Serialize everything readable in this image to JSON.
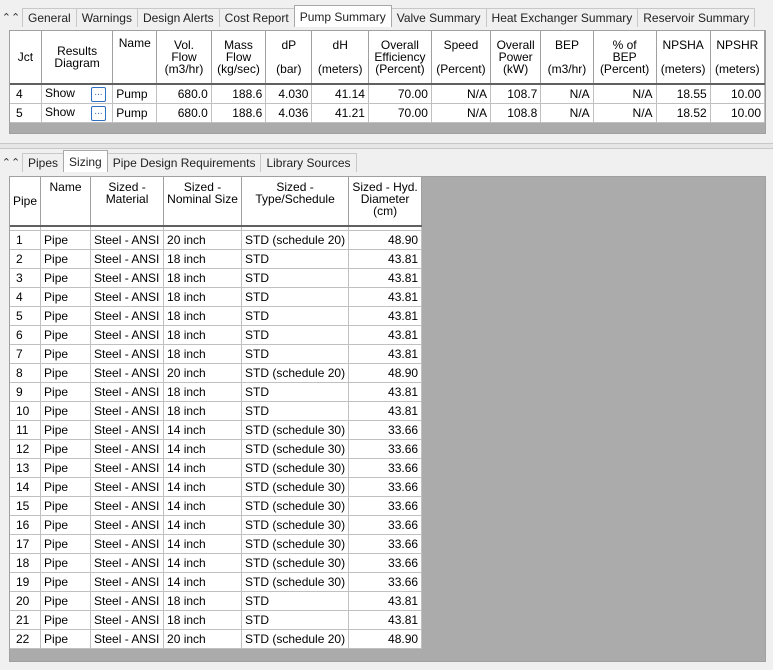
{
  "top": {
    "tabs": [
      "General",
      "Warnings",
      "Design Alerts",
      "Cost Report",
      "Pump Summary",
      "Valve Summary",
      "Heat Exchanger Summary",
      "Reservoir Summary"
    ],
    "active_tab": "Pump Summary",
    "columns": [
      {
        "top": "",
        "mid": "Jct",
        "unit": ""
      },
      {
        "top": "Results",
        "mid": "Diagram",
        "unit": ""
      },
      {
        "top": "Name",
        "mid": "",
        "unit": ""
      },
      {
        "top": "Vol.",
        "mid": "Flow",
        "unit": "(m3/hr)"
      },
      {
        "top": "Mass",
        "mid": "Flow",
        "unit": "(kg/sec)"
      },
      {
        "top": "dP",
        "mid": "",
        "unit": "(bar)"
      },
      {
        "top": "dH",
        "mid": "",
        "unit": "(meters)"
      },
      {
        "top": "Overall",
        "mid": "Efficiency",
        "unit": "(Percent)"
      },
      {
        "top": "Speed",
        "mid": "",
        "unit": "(Percent)"
      },
      {
        "top": "Overall",
        "mid": "Power",
        "unit": "(kW)"
      },
      {
        "top": "BEP",
        "mid": "",
        "unit": "(m3/hr)"
      },
      {
        "top": "% of",
        "mid": "BEP",
        "unit": "(Percent)"
      },
      {
        "top": "NPSHA",
        "mid": "",
        "unit": "(meters)"
      },
      {
        "top": "NPSHR",
        "mid": "",
        "unit": "(meters)"
      }
    ],
    "rows": [
      {
        "jct": "4",
        "diagram": "Show",
        "name": "Pump",
        "vol_flow": "680.0",
        "mass_flow": "188.6",
        "dp": "4.030",
        "dh": "41.14",
        "eff": "70.00",
        "speed": "N/A",
        "power": "108.7",
        "bep": "N/A",
        "pct_bep": "N/A",
        "npsha": "18.55",
        "npshr": "10.00"
      },
      {
        "jct": "5",
        "diagram": "Show",
        "name": "Pump",
        "vol_flow": "680.0",
        "mass_flow": "188.6",
        "dp": "4.036",
        "dh": "41.21",
        "eff": "70.00",
        "speed": "N/A",
        "power": "108.8",
        "bep": "N/A",
        "pct_bep": "N/A",
        "npsha": "18.52",
        "npshr": "10.00"
      }
    ]
  },
  "bottom": {
    "tabs": [
      "Pipes",
      "Sizing",
      "Pipe Design Requirements",
      "Library Sources"
    ],
    "active_tab": "Sizing",
    "columns": [
      "Pipe",
      "Name",
      "Sized - Material",
      "Sized - Nominal Size",
      "Sized - Type/Schedule",
      "Sized - Hyd. Diameter (cm)"
    ],
    "rows": [
      [
        "1",
        "Pipe",
        "Steel - ANSI",
        "20 inch",
        "STD (schedule 20)",
        "48.90"
      ],
      [
        "2",
        "Pipe",
        "Steel - ANSI",
        "18 inch",
        "STD",
        "43.81"
      ],
      [
        "3",
        "Pipe",
        "Steel - ANSI",
        "18 inch",
        "STD",
        "43.81"
      ],
      [
        "4",
        "Pipe",
        "Steel - ANSI",
        "18 inch",
        "STD",
        "43.81"
      ],
      [
        "5",
        "Pipe",
        "Steel - ANSI",
        "18 inch",
        "STD",
        "43.81"
      ],
      [
        "6",
        "Pipe",
        "Steel - ANSI",
        "18 inch",
        "STD",
        "43.81"
      ],
      [
        "7",
        "Pipe",
        "Steel - ANSI",
        "18 inch",
        "STD",
        "43.81"
      ],
      [
        "8",
        "Pipe",
        "Steel - ANSI",
        "20 inch",
        "STD (schedule 20)",
        "48.90"
      ],
      [
        "9",
        "Pipe",
        "Steel - ANSI",
        "18 inch",
        "STD",
        "43.81"
      ],
      [
        "10",
        "Pipe",
        "Steel - ANSI",
        "18 inch",
        "STD",
        "43.81"
      ],
      [
        "11",
        "Pipe",
        "Steel - ANSI",
        "14 inch",
        "STD (schedule 30)",
        "33.66"
      ],
      [
        "12",
        "Pipe",
        "Steel - ANSI",
        "14 inch",
        "STD (schedule 30)",
        "33.66"
      ],
      [
        "13",
        "Pipe",
        "Steel - ANSI",
        "14 inch",
        "STD (schedule 30)",
        "33.66"
      ],
      [
        "14",
        "Pipe",
        "Steel - ANSI",
        "14 inch",
        "STD (schedule 30)",
        "33.66"
      ],
      [
        "15",
        "Pipe",
        "Steel - ANSI",
        "14 inch",
        "STD (schedule 30)",
        "33.66"
      ],
      [
        "16",
        "Pipe",
        "Steel - ANSI",
        "14 inch",
        "STD (schedule 30)",
        "33.66"
      ],
      [
        "17",
        "Pipe",
        "Steel - ANSI",
        "14 inch",
        "STD (schedule 30)",
        "33.66"
      ],
      [
        "18",
        "Pipe",
        "Steel - ANSI",
        "14 inch",
        "STD (schedule 30)",
        "33.66"
      ],
      [
        "19",
        "Pipe",
        "Steel - ANSI",
        "14 inch",
        "STD (schedule 30)",
        "33.66"
      ],
      [
        "20",
        "Pipe",
        "Steel - ANSI",
        "18 inch",
        "STD",
        "43.81"
      ],
      [
        "21",
        "Pipe",
        "Steel - ANSI",
        "18 inch",
        "STD",
        "43.81"
      ],
      [
        "22",
        "Pipe",
        "Steel - ANSI",
        "20 inch",
        "STD (schedule 20)",
        "48.90"
      ]
    ]
  },
  "icons": {
    "collapse": "double-chevron-up-icon",
    "diagram_button": "ellipsis-icon"
  }
}
